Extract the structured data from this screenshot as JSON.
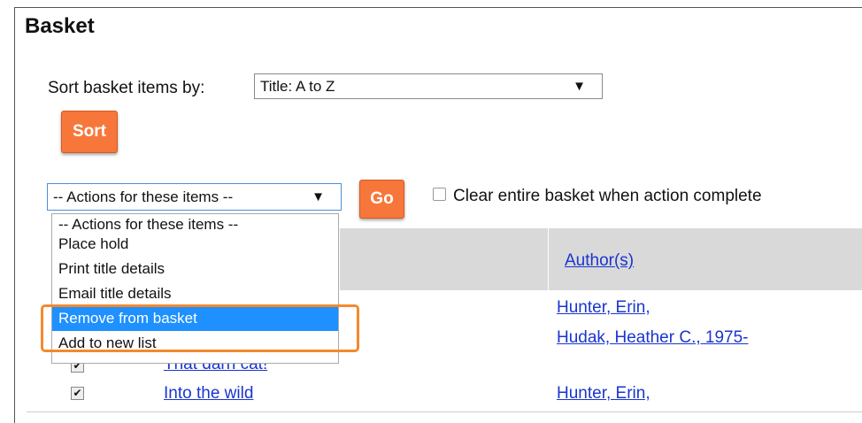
{
  "page": {
    "title": "Basket"
  },
  "sort": {
    "label": "Sort basket items by:",
    "selected": "Title: A to Z",
    "button": "Sort"
  },
  "actions": {
    "selected": "-- Actions for these items --",
    "go_button": "Go",
    "clear_label": "Clear entire basket when action complete",
    "clear_checked": false,
    "options": [
      "-- Actions for these items --",
      "Place hold",
      "Print title details",
      "Email title details",
      "Remove from basket",
      "Add to new list"
    ],
    "highlighted_option": "Remove from basket"
  },
  "table": {
    "author_header": "Author(s)",
    "rows": [
      {
        "title": "",
        "authors": [
          "Hunter, Erin,",
          "Hudak, Heather C., 1975-"
        ],
        "checked": false
      },
      {
        "title": "That darn cat!",
        "authors": [],
        "checked": true
      },
      {
        "title": "Into the wild",
        "authors": [
          "Hunter, Erin,"
        ],
        "checked": true
      }
    ]
  },
  "colors": {
    "accent_button": "#f7773a",
    "link": "#1a35cf",
    "highlight_outline": "#f5892b",
    "selected_option": "#1e90ff"
  },
  "icons": {
    "dropdown_arrow": "triangle-down-icon",
    "checkbox": "check-icon"
  }
}
